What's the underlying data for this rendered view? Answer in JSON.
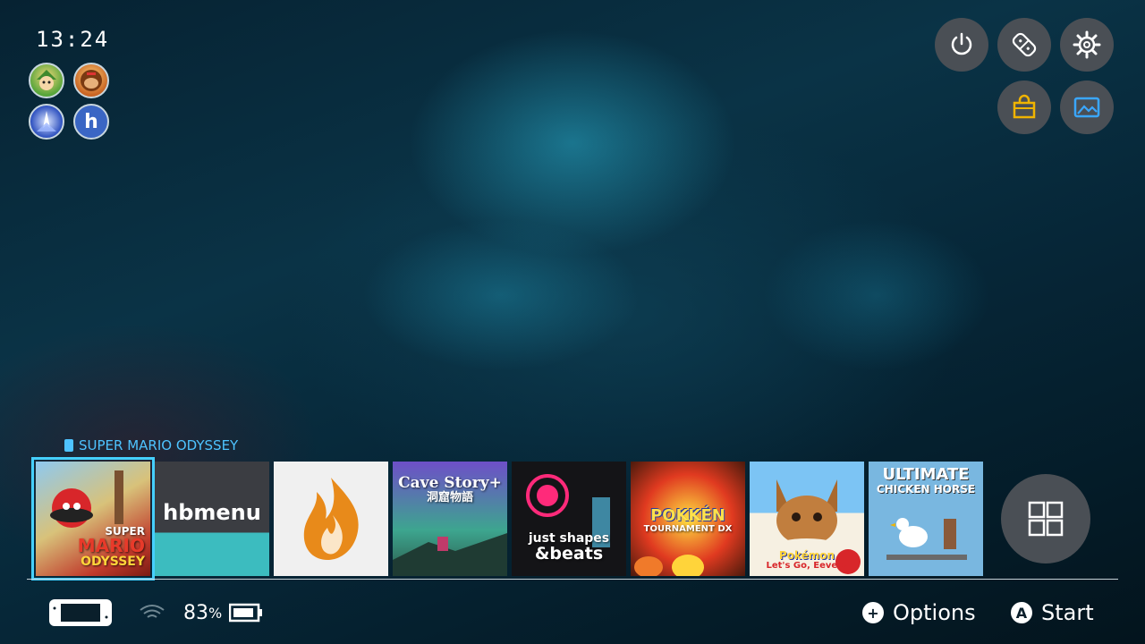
{
  "status": {
    "time": "13:24",
    "battery_percent": "83",
    "battery_unit": "%"
  },
  "users": [
    {
      "name": "user-link",
      "initial": ""
    },
    {
      "name": "user-dk",
      "initial": ""
    },
    {
      "name": "user-starfox",
      "initial": ""
    },
    {
      "name": "user-homebrew",
      "initial": "h"
    }
  ],
  "top_buttons": [
    "power-icon",
    "controller-icon",
    "settings-icon",
    "shop-icon",
    "album-icon"
  ],
  "selected_title": "SUPER MARIO ODYSSEY",
  "tiles": [
    {
      "id": "super-mario-odyssey",
      "line1": "SUPER",
      "line2": "MARIO",
      "line3": "ODYSSEY"
    },
    {
      "id": "hbmenu",
      "label": "hbmenu"
    },
    {
      "id": "flame-app"
    },
    {
      "id": "cave-story",
      "line1": "Cave Story+",
      "line2": "洞窟物語"
    },
    {
      "id": "just-shapes-beats",
      "line1": "just shapes",
      "line2": "&beats"
    },
    {
      "id": "pokken-dx",
      "line1": "POKKÉN",
      "line2": "TOURNAMENT DX"
    },
    {
      "id": "pokemon-eevee",
      "line1": "Pokémon",
      "line2": "Let's Go, Eevee!"
    },
    {
      "id": "ultimate-chicken-horse",
      "line1": "ULTIMATE",
      "line2": "CHICKEN HORSE"
    }
  ],
  "hints": {
    "options_symbol": "+",
    "options_label": "Options",
    "start_symbol": "A",
    "start_label": "Start"
  },
  "colors": {
    "accent": "#45d0ff",
    "shop": "#f0b400",
    "album": "#3aa7ff"
  }
}
